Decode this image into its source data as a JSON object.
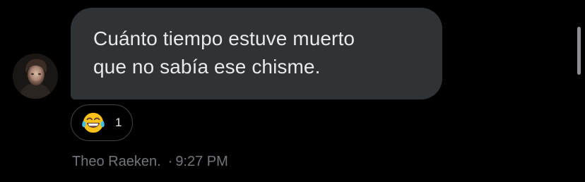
{
  "message": {
    "text": "Cuánto tiempo estuve muerto\nque no sabía ese chisme.",
    "bubble_color": "#2f3336"
  },
  "reaction": {
    "emoji_icon": "face-with-tears-of-joy-icon",
    "count": "1"
  },
  "meta": {
    "sender": "Theo Raeken.",
    "separator": "·",
    "time": "9:27 PM"
  },
  "colors": {
    "background": "#000000",
    "text": "#e7e9ea",
    "muted": "#71767b"
  }
}
